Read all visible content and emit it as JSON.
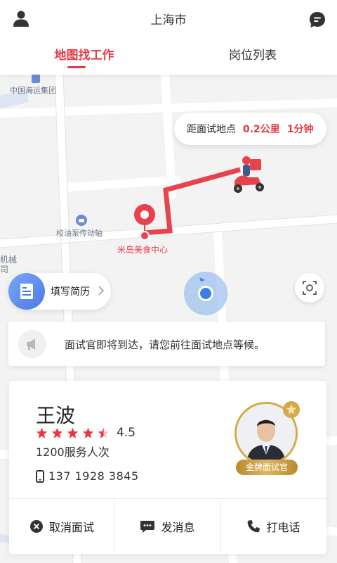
{
  "header": {
    "city": "上海市",
    "user_icon": "user-icon",
    "chat_icon": "chat-bubble-icon"
  },
  "tabs": [
    {
      "label": "地图找工作",
      "active": true
    },
    {
      "label": "岗位列表",
      "active": false
    }
  ],
  "map": {
    "labels": {
      "poi_1": "中国海运集团",
      "poi_2": "校油泵传动轴",
      "poi_3_line1": "机械",
      "poi_3_line2": "司",
      "destination": "米岛美食中心"
    },
    "route_color": "#e8424e"
  },
  "distance_bubble": {
    "label": "距面试地点",
    "distance": "0.2公里",
    "time": "1分钟"
  },
  "resume_button": {
    "label": "填写简历"
  },
  "notice": {
    "text": "面试官即将到达，请您前往面试地点等候。"
  },
  "interviewer": {
    "name": "王波",
    "rating": "4.5",
    "rating_stars": 4.5,
    "served": "1200服务人次",
    "phone": "137 1928 3845",
    "badge": "金牌面试官"
  },
  "actions": [
    {
      "label": "取消面试",
      "icon": "cancel-icon"
    },
    {
      "label": "发消息",
      "icon": "message-icon"
    },
    {
      "label": "打电话",
      "icon": "phone-icon"
    }
  ],
  "colors": {
    "accent": "#e63946",
    "gold": "#d4a949",
    "blue": "#4a79e6"
  }
}
